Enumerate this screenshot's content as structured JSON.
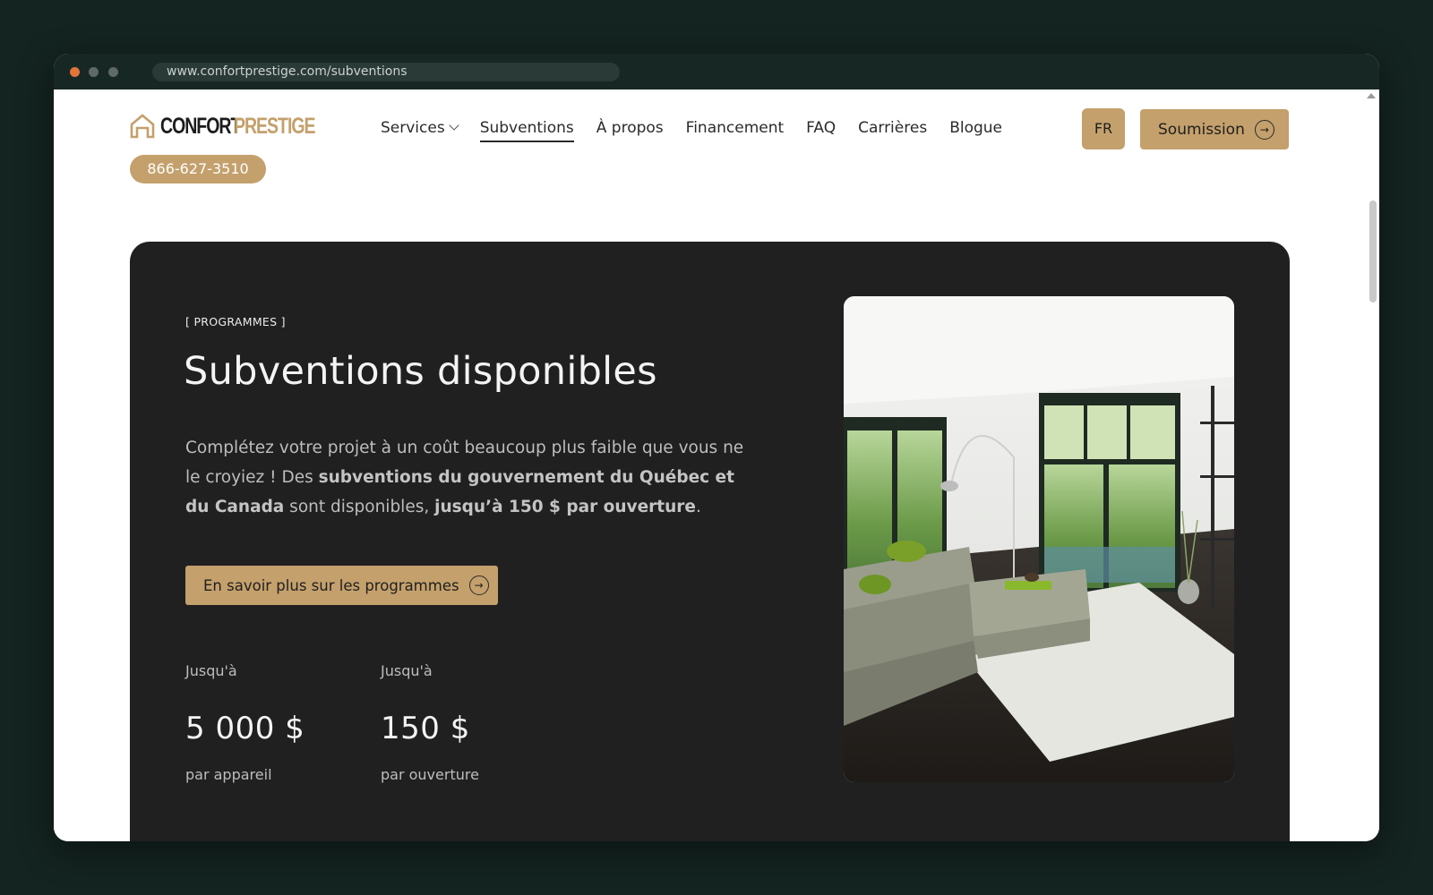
{
  "browser": {
    "url": "www.confortprestige.com/subventions"
  },
  "header": {
    "logo_word1": "CONFORT",
    "logo_word2": "PRESTIGE",
    "phone": "866-627-3510",
    "nav": {
      "services": "Services",
      "subventions": "Subventions",
      "apropos": "À propos",
      "financement": "Financement",
      "faq": "FAQ",
      "carrieres": "Carrières",
      "blogue": "Blogue"
    },
    "active_nav": "Subventions",
    "lang": "FR",
    "quote_label": "Soumission"
  },
  "hero": {
    "eyebrow": "[ PROGRAMMES ]",
    "title": "Subventions disponibles",
    "desc": {
      "p1": "Complétez votre projet à un coût beaucoup plus faible que vous ne le croyiez ! Des ",
      "b1": "subventions du gouvernement du Québec et du Canada",
      "p2": " sont disponibles, ",
      "b2": "jusqu’à 150 $ par ouverture",
      "p3": "."
    },
    "cta_label": "En savoir plus sur les programmes",
    "stats": [
      {
        "label": "Jusqu'à",
        "value": "5 000 $",
        "unit": "par appareil"
      },
      {
        "label": "Jusqu'à",
        "value": "150 $",
        "unit": "par ouverture"
      }
    ]
  },
  "colors": {
    "accent": "#c4a06c",
    "hero_bg": "#202020",
    "outer_bg": "#142420"
  },
  "icons": {
    "arrow": "arrow-right-circle-icon",
    "chevron": "chevron-down-icon",
    "logo": "house-outline-icon"
  }
}
